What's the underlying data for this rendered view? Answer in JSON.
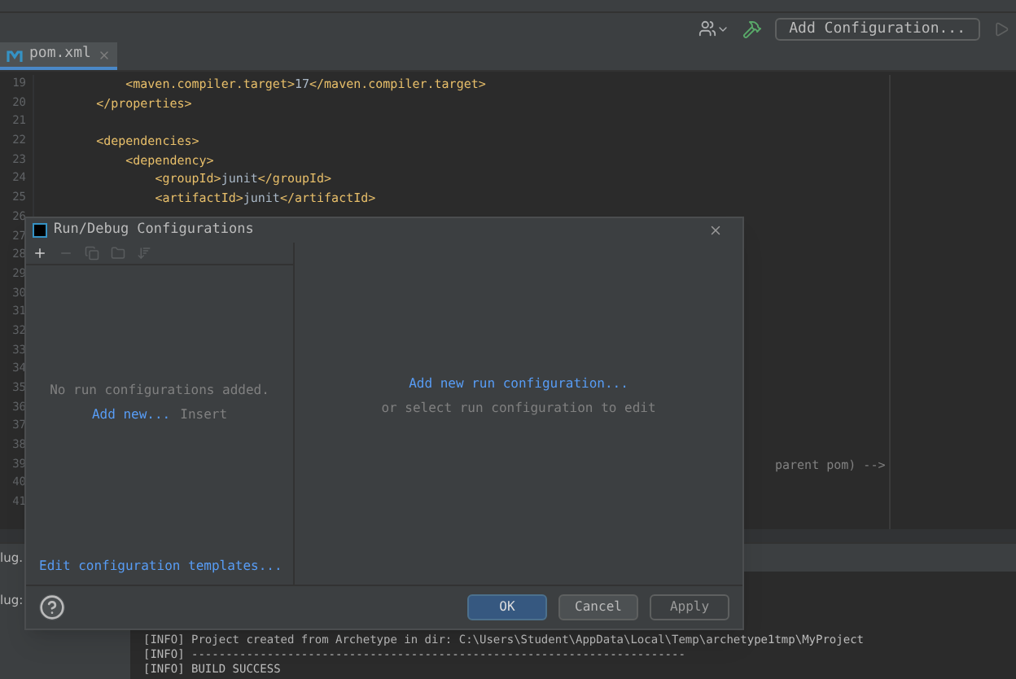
{
  "toolbar": {
    "config_button": "Add Configuration..."
  },
  "tabs": [
    {
      "label": "pom.xml",
      "selected": true
    }
  ],
  "editor": {
    "lines": [
      {
        "number": "19",
        "code": "        <maven.compiler.target>17</maven.compiler.target>"
      },
      {
        "number": "20",
        "code": "    </properties>"
      },
      {
        "number": "21"
      },
      {
        "number": "22",
        "code": "    <dependencies>"
      },
      {
        "number": "23",
        "code": "        <dependency>"
      },
      {
        "number": "24",
        "code": "            <groupId>junit</groupId>"
      },
      {
        "number": "25",
        "code": "            <artifactId>junit</artifactId>"
      },
      {
        "number": "26"
      },
      {
        "number": "27"
      },
      {
        "number": "28"
      },
      {
        "number": "29"
      },
      {
        "number": "30"
      },
      {
        "number": "31"
      },
      {
        "number": "32"
      },
      {
        "number": "33"
      },
      {
        "number": "34"
      },
      {
        "number": "35"
      },
      {
        "number": "36"
      },
      {
        "number": "37"
      },
      {
        "number": "38"
      },
      {
        "number": "39",
        "code": "parent pom) -->",
        "kind": "covered"
      },
      {
        "number": "40"
      },
      {
        "number": "41"
      }
    ]
  },
  "tool_window": {
    "tab": "lug.",
    "side_label": "lug:",
    "console": [
      "[INFO] Project created from Archetype in dir: C:\\Users\\Student\\AppData\\Local\\Temp\\archetype1tmp\\MyProject",
      "[INFO] ------------------------------------------------------------------------",
      "[INFO] BUILD SUCCESS"
    ]
  },
  "dialog": {
    "title": "Run/Debug Configurations",
    "tools": [
      {
        "kind": "add",
        "disabled": false
      },
      {
        "kind": "remove",
        "disabled": true
      },
      {
        "kind": "copy",
        "disabled": true
      },
      {
        "kind": "folder",
        "disabled": true
      },
      {
        "kind": "sort",
        "disabled": true
      }
    ],
    "empty_message": "No run configurations added.",
    "add_link": "Add new...",
    "add_shortcut": "Insert",
    "templates_link": "Edit configuration templates...",
    "right_link": "Add new run configuration...",
    "right_hint": "or select run configuration to edit",
    "buttons": [
      {
        "label": "OK",
        "kind": "primary",
        "disabled": false
      },
      {
        "label": "Cancel",
        "kind": "normal",
        "disabled": false
      },
      {
        "label": "Apply",
        "kind": "normal",
        "disabled": true
      }
    ]
  }
}
